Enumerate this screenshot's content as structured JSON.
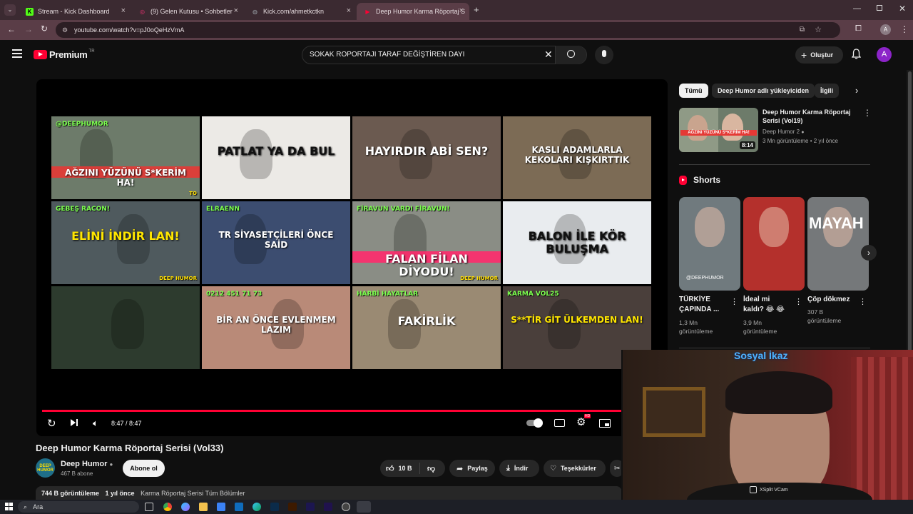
{
  "tabs": [
    {
      "title": "Stream - Kick Dashboard",
      "fav": "K",
      "fav_color": "#53fc18"
    },
    {
      "title": "(9) Gelen Kutusu • Sohbetler",
      "fav": "◎",
      "fav_color": "#e1306c"
    },
    {
      "title": "Kick.com/ahmetkctkn",
      "fav": "◍",
      "fav_color": "#9aa0a6"
    },
    {
      "title": "Deep Humor Karma Röportaj S",
      "fav": "▶",
      "fav_color": "#ff0033"
    }
  ],
  "address": {
    "url": "youtube.com/watch?v=pJ0oQeHzVmA",
    "profile": "A"
  },
  "header": {
    "logo": "Premium",
    "region": "TR",
    "search_query": "SOKAK ROPORTAJI TARAF DEĞİŞTİREN DAYI",
    "create_label": "Oluştur",
    "avatar": "A"
  },
  "player": {
    "time": "8:47 / 8:47",
    "progress": 1.0,
    "hd_badge": "HD",
    "thumbnails": [
      {
        "text": "AĞZINI YÜZÜNÜ S*KERİM HA!",
        "sub": "@DEEPHUMOR",
        "bg": "#6d7b6a",
        "color": "#ffffff",
        "bar": "#e53935",
        "corner": "TO"
      },
      {
        "text": "PATLAT YA DA BUL",
        "sub": "",
        "bg": "#eceae6",
        "color": "#111111",
        "bar": "",
        "corner": ""
      },
      {
        "text": "HAYIRDIR ABİ SEN?",
        "sub": "",
        "bg": "#6b5a50",
        "color": "#ffffff",
        "bar": "",
        "corner": ""
      },
      {
        "text": "KASLI ADAMLARLA KEKOLARI KIŞKIRTTIK",
        "sub": "",
        "bg": "#7c6b55",
        "color": "#ffffff",
        "bar": "",
        "corner": ""
      },
      {
        "text": "ELİNİ İNDİR LAN!",
        "sub": "GEBEŞ RACON!",
        "bg": "#4f5a5e",
        "color": "#ffe600",
        "bar": "",
        "corner": "DEEP HUMOR"
      },
      {
        "text": "TR SİYASETÇİLERİ ÖNCE SAİD",
        "sub": "ELRAENN",
        "bg": "#3c4d70",
        "color": "#ffffff",
        "bar": "",
        "corner": ""
      },
      {
        "text": "FALAN FİLAN DİYODU!",
        "sub": "FİRAVUN VARDI FİRAVUN!",
        "bg": "#8a8d85",
        "color": "#ffffff",
        "bar": "#ff2a6d",
        "corner": "DEEP HUMOR"
      },
      {
        "text": "BALON İLE KÖR BULUŞMA",
        "sub": "",
        "bg": "#e9ecef",
        "color": "#111111",
        "bar": "",
        "corner": ""
      },
      {
        "text": "",
        "sub": "",
        "bg": "#2d3b2e",
        "color": "#ffffff",
        "bar": "",
        "corner": ""
      },
      {
        "text": "BİR AN ÖNCE EVLENMEM LAZIM",
        "sub": "0212 451 71 73",
        "bg": "#b98a78",
        "color": "#ffffff",
        "bar": "",
        "corner": ""
      },
      {
        "text": "FAKİRLİK",
        "sub": "HARBİ HAYATLAR",
        "bg": "#9a8a73",
        "color": "#ffffff",
        "bar": "",
        "corner": ""
      },
      {
        "text": "S**TİR GİT ÜLKEMDEN LAN!",
        "sub": "KARMA VOL25",
        "bg": "#4a3f3b",
        "color": "#ffe600",
        "bar": "",
        "corner": ""
      }
    ]
  },
  "video": {
    "title": "Deep Humor Karma Röportaj Serisi (Vol33)",
    "channel": "Deep Humor",
    "subscribers": "467 B abone",
    "subscribe_label": "Abone ol",
    "likes": "10 B",
    "share_label": "Paylaş",
    "download_label": "İndir",
    "thanks_label": "Teşekkürler",
    "views": "744 B görüntüleme",
    "age": "1 yıl önce",
    "description": "Karma Röportaj Serisi Tüm Bölümler",
    "avatar_text": "DEEP HUMOR"
  },
  "sidebar": {
    "chips": [
      "Tümü",
      "Deep Humor adlı yükleyiciden",
      "İlgili"
    ],
    "rec": {
      "title": "Deep Humor Karma Röportaj Serisi (Vol19)",
      "channel": "Deep Humor 2",
      "meta": "3 Mn görüntüleme • 2 yıl önce",
      "duration": "8:14",
      "thumb_text": "AĞZINI YÜZÜNÜ S*KERİM HA!"
    },
    "shorts_label": "Shorts",
    "shorts": [
      {
        "title": "TÜRKİYE ÇAPINDA ...",
        "views": "1,3 Mn görüntüleme",
        "bg": "#707a7e",
        "overlay": "@DEEPHUMOR"
      },
      {
        "title": "İdeal mi kaldı? 😂 😂",
        "views": "3,9 Mn görüntüleme",
        "bg": "#b4302c",
        "overlay": ""
      },
      {
        "title": "Çöp dökmez",
        "views": "307 B görüntüleme",
        "bg": "#75787a",
        "overlay": "MAYAH"
      }
    ]
  },
  "overlay": {
    "title": "Sosyal İkaz",
    "cam_label": "XSplit VCam"
  },
  "taskbar": {
    "search": "Ara"
  }
}
